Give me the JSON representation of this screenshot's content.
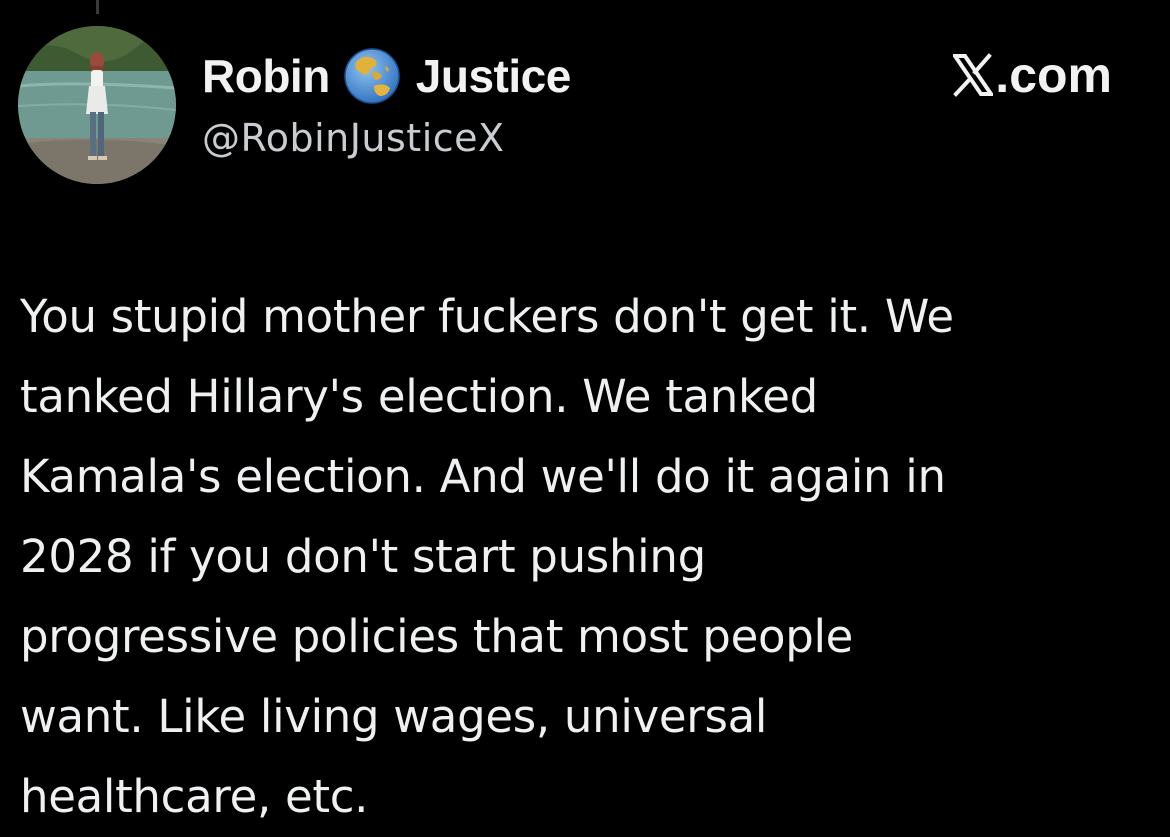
{
  "author": {
    "display_name_first": "Robin",
    "display_name_last": "Justice",
    "name_emoji": "globe-asia-australia-icon",
    "handle": "@RobinJusticeX"
  },
  "brand": {
    "label": ".com",
    "logo": "x-logo-icon"
  },
  "tweet": {
    "lines": [
      "You stupid mother fuckers don't get it. We",
      "tanked Hillary's election. We tanked",
      "Kamala's election. And we'll do it again in",
      "2028 if you don't start pushing",
      "progressive policies that most people",
      "want. Like living wages, universal",
      "healthcare, etc."
    ]
  },
  "colors": {
    "background": "#000000",
    "text_primary": "#eef0f2",
    "text_secondary": "#c9ccd0"
  }
}
